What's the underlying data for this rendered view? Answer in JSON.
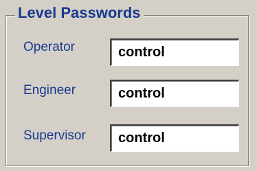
{
  "group": {
    "title": "Level Passwords"
  },
  "rows": [
    {
      "label": "Operator",
      "value": "control"
    },
    {
      "label": "Engineer",
      "value": "control"
    },
    {
      "label": "Supervisor",
      "value": "control"
    }
  ],
  "colors": {
    "label_text": "#1a3a8f",
    "background": "#d4d0c8",
    "field_background": "#ffffff"
  }
}
